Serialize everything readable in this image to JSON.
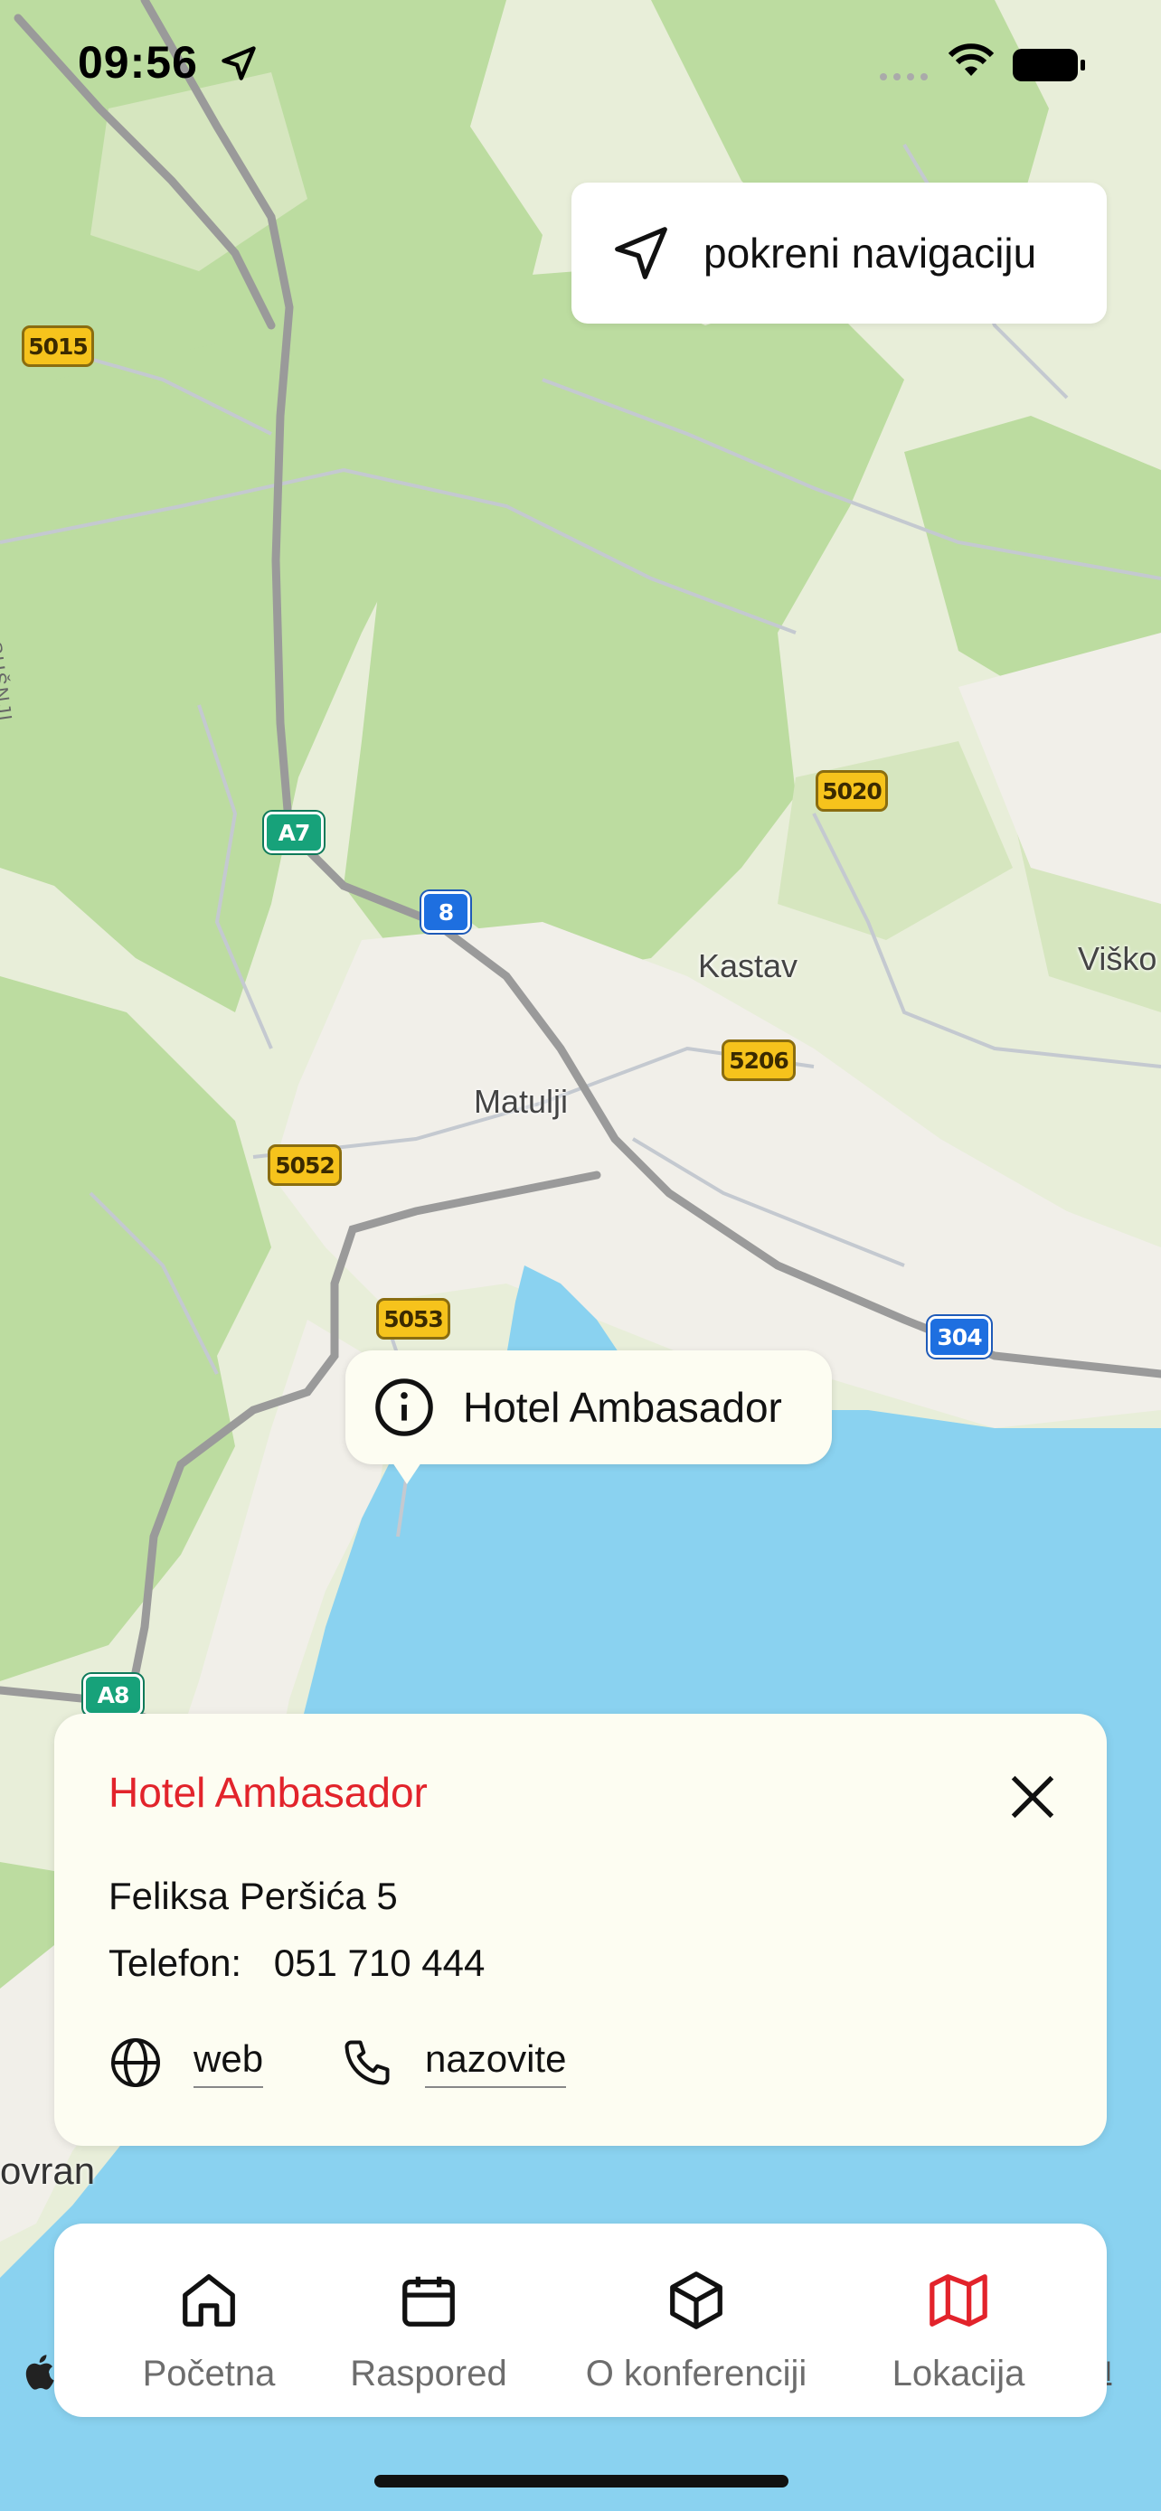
{
  "status_bar": {
    "time": "09:56",
    "location_icon": "location-arrow-icon",
    "signal": "signal-dots",
    "wifi_icon": "wifi-icon",
    "battery_icon": "battery-full-icon"
  },
  "navigation_button": {
    "label": "pokreni navigaciju",
    "icon": "navigation-arrow-icon"
  },
  "map": {
    "places": {
      "kastav": "Kastav",
      "matulji": "Matulji",
      "visko": "Viško",
      "susnji": "SUŠNJI",
      "opatija_partial": "ovran"
    },
    "road_badges": {
      "r5015": "5015",
      "r5020": "5020",
      "r5206": "5206",
      "r5052": "5052",
      "r5053": "5053",
      "a7": "A7",
      "r8": "8",
      "r304": "304",
      "a8": "A8"
    },
    "legal_text": "al",
    "colors": {
      "land": "#e8eed9",
      "forest": "#bcdca0",
      "urban": "#f1efe9",
      "water": "#8ad2f0",
      "highway": "#9a9a9a"
    }
  },
  "poi_callout": {
    "label": "Hotel Ambasador",
    "icon": "info-circle-icon"
  },
  "info_card": {
    "title": "Hotel Ambasador",
    "address": "Feliksa Peršića 5",
    "phone_label": "Telefon:",
    "phone_value": "051 710 444",
    "web_label": "web",
    "call_label": "nazovite",
    "accent_color": "#e2232b"
  },
  "tab_bar": {
    "tabs": [
      {
        "label": "Početna",
        "icon": "home-icon"
      },
      {
        "label": "Raspored",
        "icon": "calendar-icon"
      },
      {
        "label": "O konferenciji",
        "icon": "cube-icon"
      },
      {
        "label": "Lokacija",
        "icon": "map-icon",
        "active": true
      }
    ],
    "active_color": "#e2232b"
  }
}
